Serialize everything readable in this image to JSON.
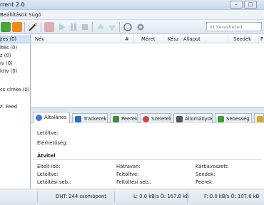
{
  "window": {
    "title": "rrent 2.0",
    "minimize": "–",
    "maximize": "□"
  },
  "menu": {
    "settings": "Beállítások",
    "help": "Súgó"
  },
  "search": {
    "placeholder": "Itt keresheted"
  },
  "sidebar": {
    "items": [
      {
        "label": "zes (0)"
      },
      {
        "label": "ltés (0)"
      },
      {
        "label": "z (0)"
      },
      {
        "label": "iv (0)"
      },
      {
        "label": "ktív (0)"
      },
      {
        "label": "cs címke (0)"
      },
      {
        "label": "z. Feed"
      }
    ]
  },
  "list": {
    "columns": {
      "name": "Név",
      "num": "#",
      "size": "Méret",
      "done": "Kész",
      "status": "Állapot",
      "seeds": "Seedek",
      "peers": "P"
    }
  },
  "tabs": [
    {
      "label": "Általános",
      "color": "#3a7bd5"
    },
    {
      "label": "Trackerek",
      "color": "#2f6fb3"
    },
    {
      "label": "Peerek",
      "color": "#3f8f3a"
    },
    {
      "label": "Szeletek",
      "color": "#c44"
    },
    {
      "label": "Állományok",
      "color": "#555"
    },
    {
      "label": "Sebesség",
      "color": "#3a9e3a"
    }
  ],
  "general": {
    "downloaded": "Letöltve:",
    "availability": "Elérhetőség:",
    "transfer_title": "Átvitel",
    "elapsed": "Eltelt idő:",
    "remaining": "Hátravan:",
    "wasted": "Kárbaveszett:",
    "downloaded2": "Letöltve:",
    "uploaded": "Feltöltve:",
    "seeds": "Seedek:",
    "down_speed": "Letöltési seb.:",
    "up_speed": "Feltöltési seb.:",
    "peers": "Peerek:"
  },
  "status": {
    "dht": "DHT: 244 csomópont",
    "download": "L: 0.0 kB/s Ö: 167.8 kB",
    "upload": "F: 0.0 kB/s Ö: 107.6 kB"
  }
}
